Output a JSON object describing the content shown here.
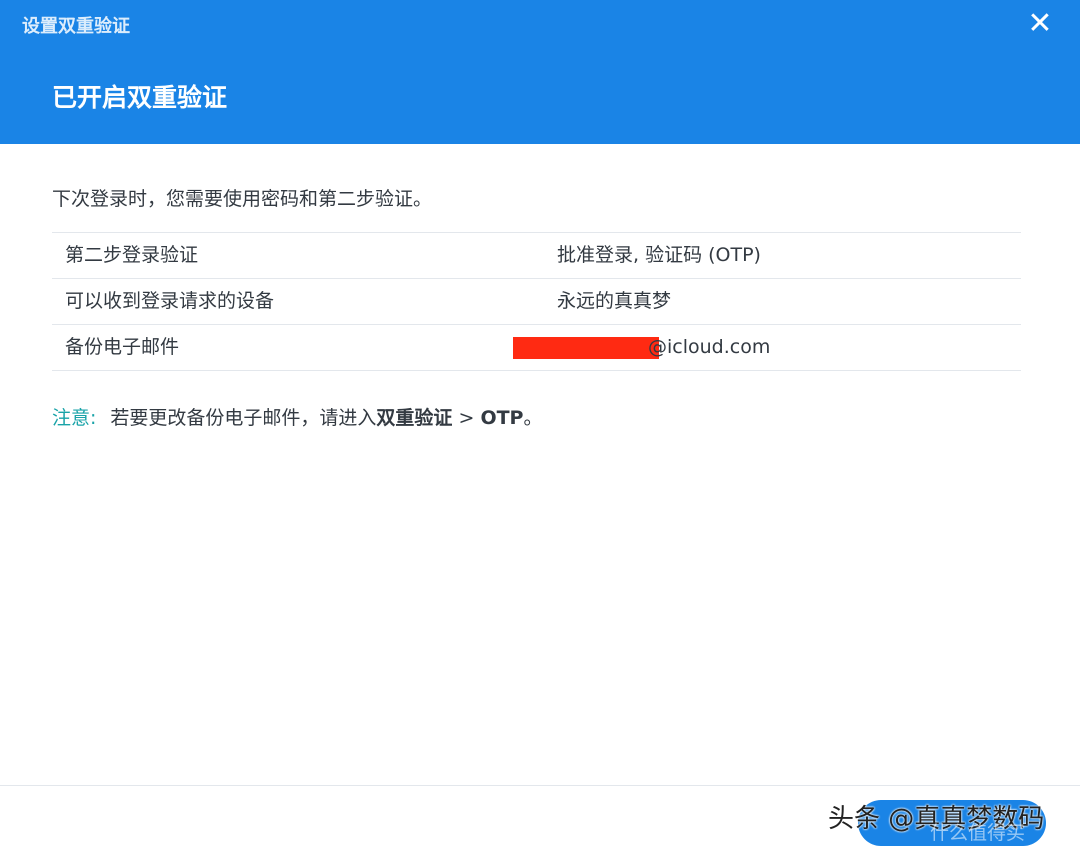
{
  "window": {
    "title": "设置双重验证",
    "close_icon": "close-icon"
  },
  "header": {
    "heading": "已开启双重验证"
  },
  "content": {
    "intro": "下次登录时，您需要使用密码和第二步验证。",
    "rows": [
      {
        "label": "第二步登录验证",
        "value": "批准登录, 验证码 (OTP)"
      },
      {
        "label": "可以收到登录请求的设备",
        "value": "永远的真真梦"
      },
      {
        "label": "备份电子邮件",
        "value": "@icloud.com"
      }
    ],
    "note": {
      "label": "注意:",
      "text_prefix": "若要更改备份电子邮件，请进入",
      "path_1": "双重验证",
      "separator": " > ",
      "path_2": "OTP",
      "suffix": "。"
    }
  },
  "watermark": {
    "line1": "头条 @真真梦数码",
    "line2": "什么值得买"
  },
  "colors": {
    "header_bg": "#1a84e6",
    "note_label": "#19a3a8",
    "redaction": "#ff2a12"
  }
}
